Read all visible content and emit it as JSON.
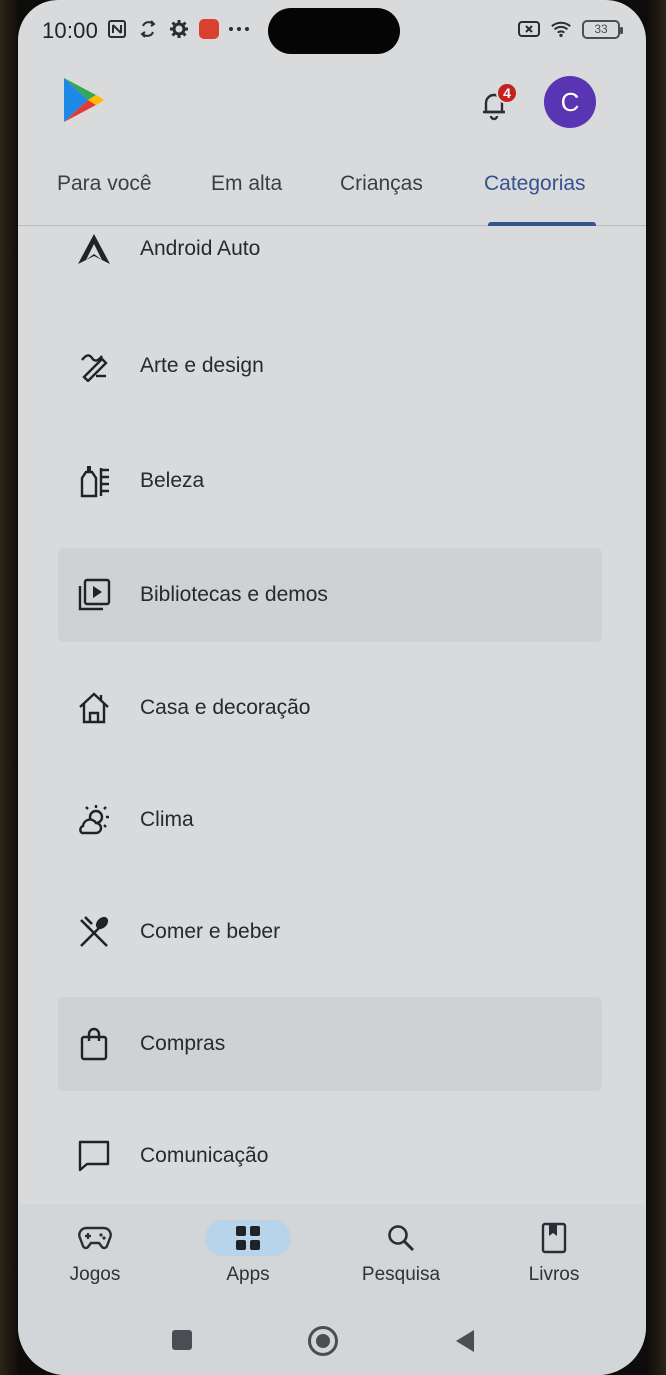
{
  "status_bar": {
    "time": "10:00",
    "battery": "33",
    "left_icons": [
      "nfc-icon",
      "sync-icon",
      "gear-icon",
      "app-notification-icon",
      "more-icon"
    ],
    "right_icons": [
      "sim-off-icon",
      "wifi-icon",
      "battery-icon"
    ]
  },
  "header": {
    "logo": "google-play-logo",
    "notification_count": "4",
    "avatar_letter": "C",
    "accent_color": "#5a35b3"
  },
  "tabs": [
    {
      "label": "Para você",
      "active": false
    },
    {
      "label": "Em alta",
      "active": false
    },
    {
      "label": "Crianças",
      "active": false
    },
    {
      "label": "Categorias",
      "active": true
    }
  ],
  "categories": [
    {
      "label": "Android Auto",
      "icon": "android-auto-icon"
    },
    {
      "label": "Arte e design",
      "icon": "pen-brush-icon"
    },
    {
      "label": "Beleza",
      "icon": "beauty-bottle-icon"
    },
    {
      "label": "Bibliotecas e demos",
      "icon": "video-library-icon"
    },
    {
      "label": "Casa e decoração",
      "icon": "house-icon"
    },
    {
      "label": "Clima",
      "icon": "weather-icon"
    },
    {
      "label": "Comer e beber",
      "icon": "cutlery-icon"
    },
    {
      "label": "Compras",
      "icon": "shopping-bag-icon"
    },
    {
      "label": "Comunicação",
      "icon": "chat-bubble-icon"
    }
  ],
  "bottom_nav": [
    {
      "label": "Jogos",
      "icon": "gamepad-icon",
      "active": false
    },
    {
      "label": "Apps",
      "icon": "apps-grid-icon",
      "active": true
    },
    {
      "label": "Pesquisa",
      "icon": "search-icon",
      "active": false
    },
    {
      "label": "Livros",
      "icon": "bookmark-book-icon",
      "active": false
    }
  ],
  "colors": {
    "tab_active": "#36538f",
    "nav_active_pill": "#b8d4ea",
    "badge": "#c5221f"
  }
}
